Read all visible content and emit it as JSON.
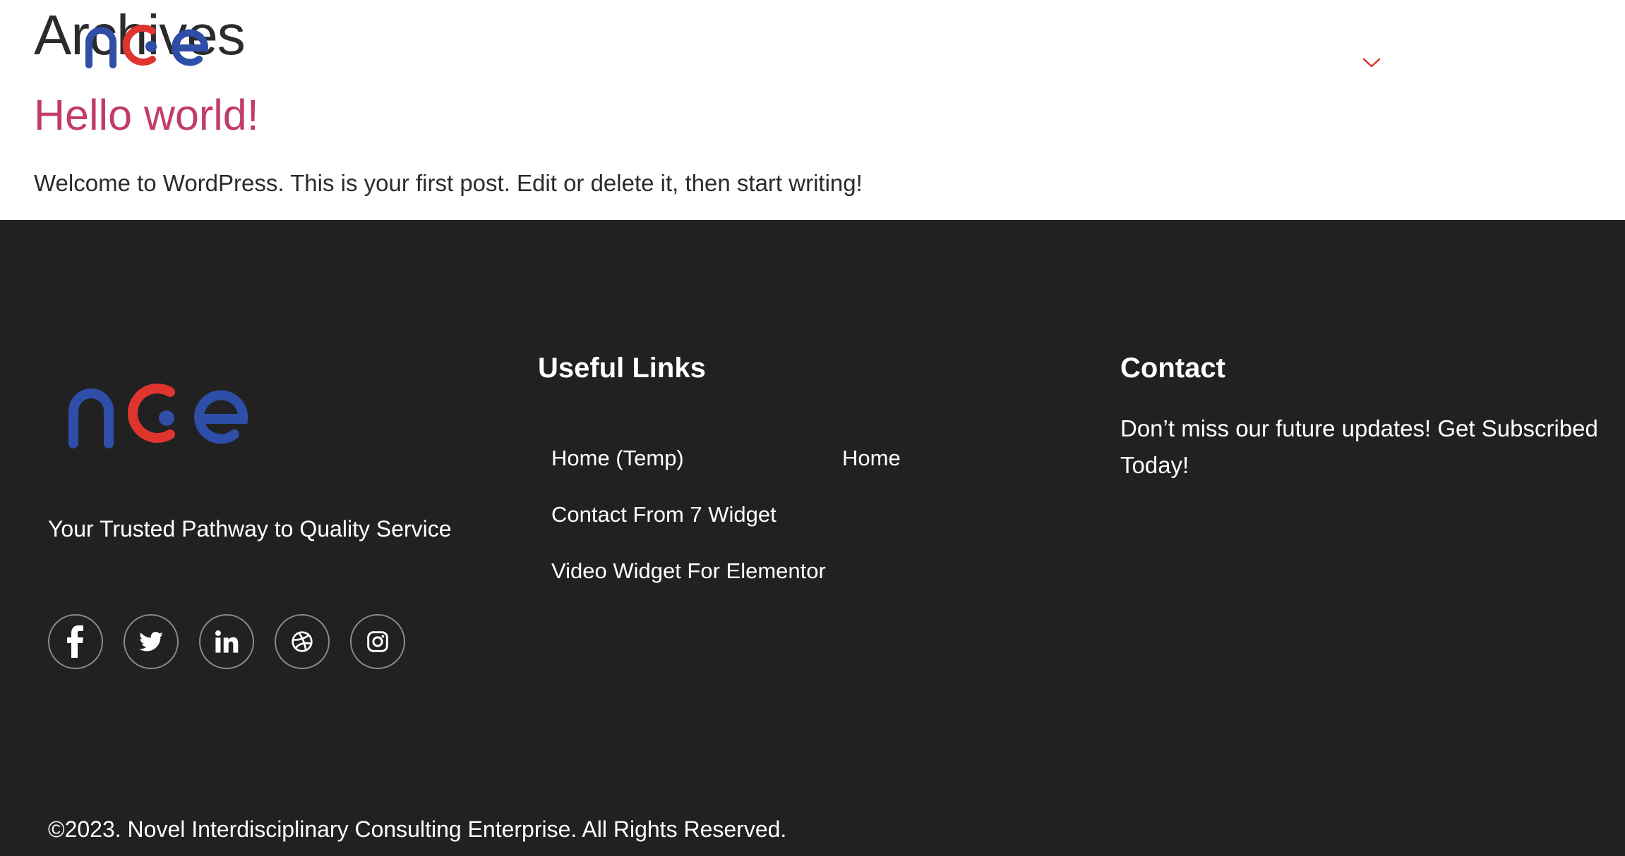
{
  "header": {
    "archives_title": "Archives",
    "logo_name": "nice-logo",
    "menu_icon": "chevron-down-icon"
  },
  "post": {
    "title": "Hello world!",
    "excerpt": "Welcome to WordPress. This is your first post. Edit or delete it, then start writing!"
  },
  "footer": {
    "tagline": "Your Trusted Pathway to Quality Service",
    "socials": [
      "facebook-icon",
      "twitter-icon",
      "linkedin-icon",
      "dribbble-icon",
      "instagram-icon"
    ],
    "useful_links": {
      "heading": "Useful Links",
      "items": [
        "Home (Temp)",
        "Home",
        "Contact From 7 Widget",
        "Video Widget For Elementor"
      ]
    },
    "contact": {
      "heading": "Contact",
      "text": "Don’t miss our future updates! Get Subscribed Today!"
    },
    "copyright": "©2023. Novel Interdisciplinary Consulting Enterprise. All Rights Reserved."
  },
  "colors": {
    "brand_blue": "#2f4ea8",
    "brand_red": "#e0342f",
    "post_title": "#c23b6c",
    "footer_bg": "#212121"
  }
}
